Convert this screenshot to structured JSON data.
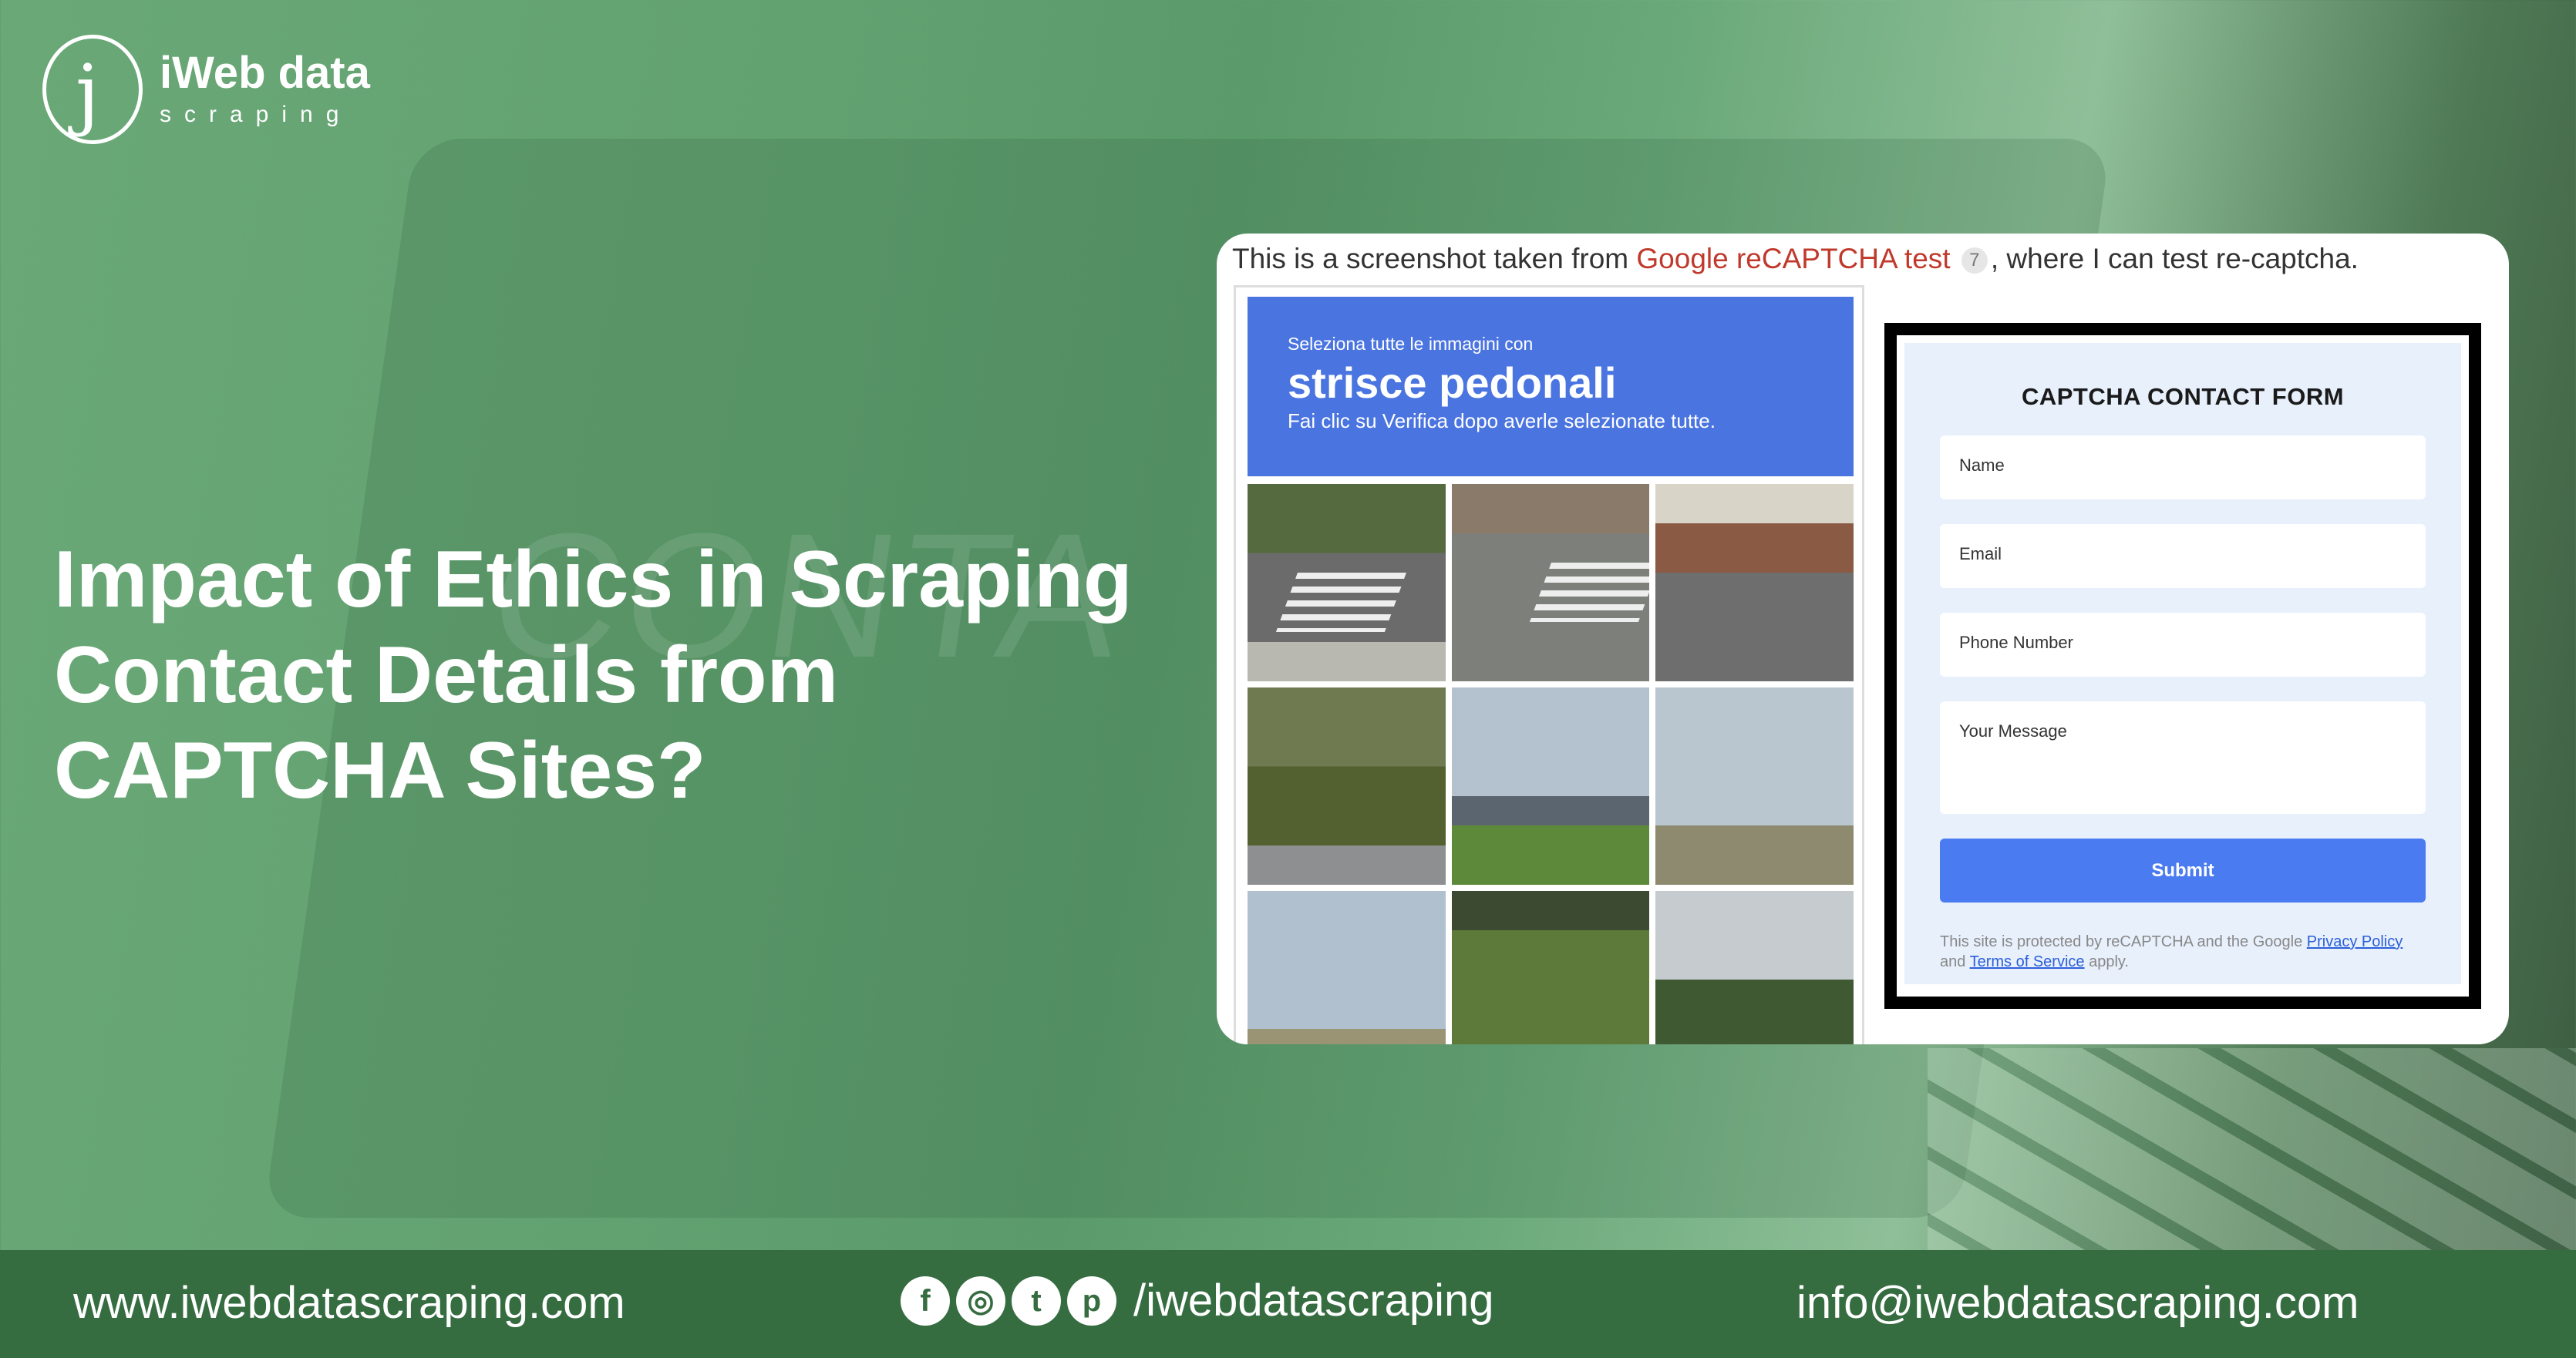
{
  "brand": {
    "logo_letter": "j",
    "name": "iWeb data",
    "tagline": "scraping"
  },
  "headline": "Impact of Ethics in Scraping Contact Details from CAPTCHA Sites?",
  "card": {
    "caption_before": "This is a screenshot taken from ",
    "caption_link": "Google reCAPTCHA test",
    "caption_badge": "7",
    "caption_after": ", where I can test re-captcha.",
    "captcha": {
      "prompt_small": "Seleziona tutte le immagini con",
      "prompt_big": "strisce pedonali",
      "prompt_note": "Fai clic su Verifica dopo averle selezionate tutte.",
      "tiles": [
        "crosswalk-corner",
        "crosswalk-intersection",
        "street-crosswalk",
        "truck-trees",
        "palm-trees-building",
        "traffic-light",
        "highway-road",
        "grass-person",
        "trees-sky"
      ]
    },
    "form": {
      "title": "CAPTCHA CONTACT FORM",
      "name_placeholder": "Name",
      "email_placeholder": "Email",
      "phone_placeholder": "Phone Number",
      "message_placeholder": "Your Message",
      "submit_label": "Submit",
      "disclaimer_1": "This site is protected by reCAPTCHA and the Google ",
      "privacy_link": "Privacy Policy",
      "disclaimer_2": "and ",
      "terms_link": "Terms of Service",
      "disclaimer_3": " apply."
    }
  },
  "footer": {
    "website": "www.iwebdatascraping.com",
    "social_icons": [
      "facebook-icon",
      "instagram-icon",
      "twitter-icon",
      "pinterest-icon"
    ],
    "social_glyphs": [
      "f",
      "◎",
      "t",
      "p"
    ],
    "handle": "/iwebdatascraping",
    "email": "info@iwebdatascraping.com"
  }
}
